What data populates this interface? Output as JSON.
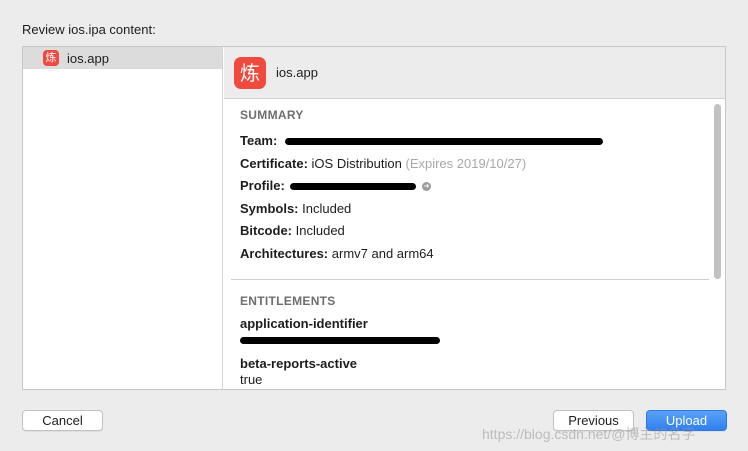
{
  "dialog": {
    "heading": "Review ios.ipa content:"
  },
  "sidebar": {
    "items": [
      {
        "label": "ios.app",
        "icon": "app-icon",
        "icon_glyph": "炼",
        "selected": true
      }
    ]
  },
  "detail": {
    "app_name": "ios.app",
    "icon_glyph": "炼",
    "summary": {
      "title": "SUMMARY",
      "team_label": "Team:",
      "certificate_label": "Certificate:",
      "certificate_value": "iOS Distribution",
      "certificate_expiry": "(Expires 2019/10/27)",
      "profile_label": "Profile:",
      "symbols_label": "Symbols:",
      "symbols_value": "Included",
      "bitcode_label": "Bitcode:",
      "bitcode_value": "Included",
      "architectures_label": "Architectures:",
      "architectures_value": "armv7 and arm64"
    },
    "entitlements": {
      "title": "ENTITLEMENTS",
      "items": [
        {
          "key": "application-identifier",
          "value": ""
        },
        {
          "key": "beta-reports-active",
          "value": "true"
        }
      ]
    }
  },
  "buttons": {
    "cancel": "Cancel",
    "previous": "Previous",
    "upload": "Upload"
  },
  "watermark": "https://blog.csdn.net/@博主的名字",
  "colors": {
    "accent": "#2f7ff0",
    "app_icon": "#f0493e",
    "muted_text": "#a8a8a8"
  }
}
